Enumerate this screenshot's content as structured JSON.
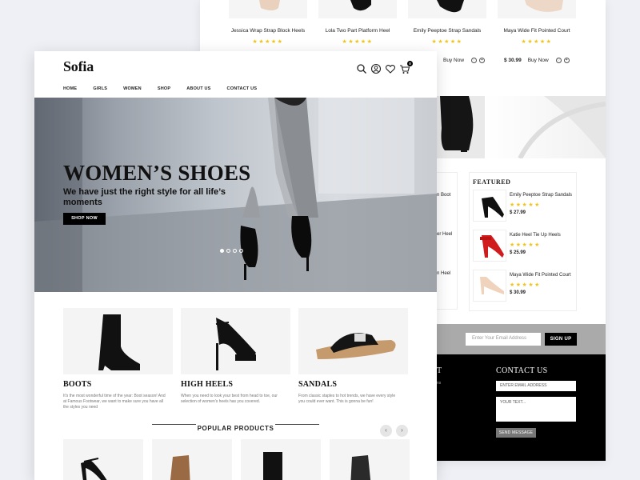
{
  "back": {
    "products": [
      {
        "name": "Jessica Wrap Strap Block Heels",
        "price": "",
        "buy": ""
      },
      {
        "name": "Lola Two Part Platform Heel",
        "price": "",
        "buy": ""
      },
      {
        "name": "Emily Peeptoe Strap Sandals",
        "price": "",
        "buy": "Buy Now"
      },
      {
        "name": "Maya Wide Fit Pointed Court",
        "price": "$ 30.99",
        "buy": "Buy Now"
      }
    ],
    "left_panel_items": [
      "n Boot",
      "er Heel",
      "n Heel"
    ],
    "featured": {
      "title": "FEATURED",
      "items": [
        {
          "name": "Emily Peeptoe Strap Sandals",
          "price": "$ 27.99"
        },
        {
          "name": "Katie Heel Tie Up Heels",
          "price": "$ 25.99"
        },
        {
          "name": "Maya Wide Fit Pointed Court",
          "price": "$ 30.99"
        }
      ]
    },
    "newsletter": {
      "placeholder": "Enter Your Email Address",
      "button": "SIGN UP"
    },
    "footer": {
      "left_stub": "T",
      "contact_title": "CONTACT US",
      "email_placeholder": "ENTER EMAIL ADDRESS",
      "text_placeholder": "YOUR TEXT...",
      "send_button": "SEND MESSAGE"
    }
  },
  "front": {
    "logo": "Sofia",
    "cart_count": "0",
    "nav": [
      "HOME",
      "GIRLS",
      "WOMEN",
      "SHOP",
      "ABOUT US",
      "CONTACT US"
    ],
    "hero": {
      "title": "WOMEN’S SHOES",
      "subtitle": "We have just the right style for all life’s moments",
      "button": "SHOP NOW"
    },
    "categories": [
      {
        "title": "BOOTS",
        "text": "It's the most wonderful time of the year: Boot season! And at Famous Footwear, we want to make sure you have all the styles you need"
      },
      {
        "title": "HIGH HEELS",
        "text": "When you need to look your best from head to toe, our selection of women's heels has you covered."
      },
      {
        "title": "SANDALS",
        "text": "From classic staples to hot trends, we have every style you could ever want. This is gonna be fun!"
      }
    ],
    "popular_title": "POPULAR PRODUCTS",
    "stars": "★★★★★"
  }
}
